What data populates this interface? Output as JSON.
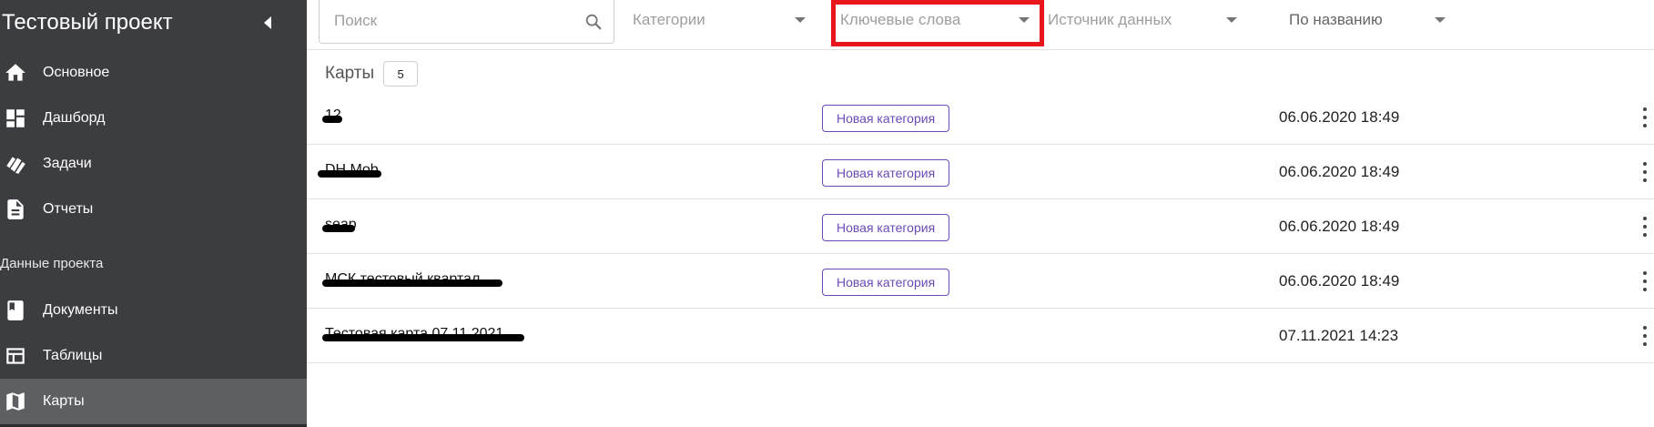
{
  "sidebar": {
    "title": "Тестовый проект",
    "collapse_icon": "chevron-left-icon",
    "nav_main": [
      {
        "label": "Основное",
        "icon": "home-icon"
      },
      {
        "label": "Дашборд",
        "icon": "dashboard-icon"
      },
      {
        "label": "Задачи",
        "icon": "tasks-icon"
      },
      {
        "label": "Отчеты",
        "icon": "report-icon"
      }
    ],
    "section_label": "Данные проекта",
    "nav_data": [
      {
        "label": "Документы",
        "icon": "document-icon"
      },
      {
        "label": "Таблицы",
        "icon": "table-icon"
      },
      {
        "label": "Карты",
        "icon": "map-icon",
        "active": true
      }
    ]
  },
  "filters": {
    "search_placeholder": "Поиск",
    "categories": "Категории",
    "keywords": "Ключевые слова",
    "data_source": "Источник данных",
    "sort": "По названию"
  },
  "cards": {
    "title": "Карты",
    "count": "5",
    "rows": [
      {
        "name": "12",
        "category": "Новая категория",
        "date": "06.06.2020 18:49"
      },
      {
        "name": "DH Mob",
        "category": "Новая категория",
        "date": "06.06.2020 18:49"
      },
      {
        "name": "seap",
        "category": "Новая категория",
        "date": "06.06.2020 18:49"
      },
      {
        "name": "МСК тестовый квартал",
        "category": "Новая категория",
        "date": "06.06.2020 18:49"
      },
      {
        "name": "Тестовая карта 07.11.2021",
        "category": "",
        "date": "07.11.2021 14:23"
      }
    ]
  },
  "colors": {
    "sidebar_bg": "#3c3d40",
    "sidebar_active": "#5e5f62",
    "tag_accent": "#6a4bb5",
    "highlight": "#e8151c"
  }
}
